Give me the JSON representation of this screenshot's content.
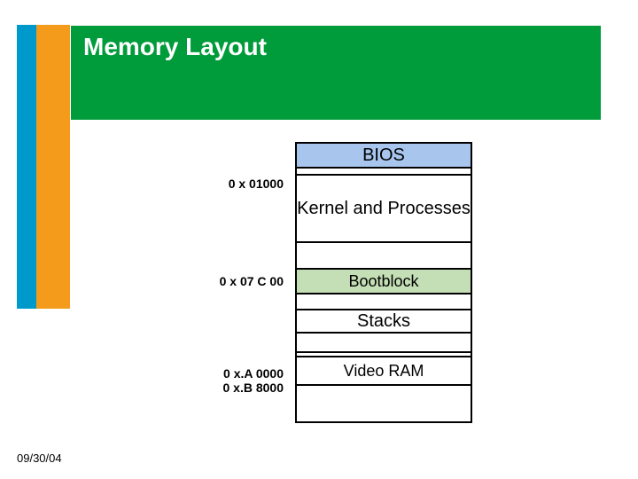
{
  "title": "Memory Layout",
  "addresses": {
    "a1": "0 x 01000",
    "a2": "0 x 07 C 00",
    "a3": "0 x.A 0000",
    "a4": "0 x.B 8000"
  },
  "regions": {
    "bios": "BIOS",
    "kernel": "Kernel and Processes",
    "bootblock": "Bootblock",
    "stacks": "Stacks",
    "videoram": "Video RAM"
  },
  "footer": {
    "date": "09/30/04"
  },
  "colors": {
    "blue": "#0099cc",
    "orange": "#f49b1b",
    "green": "#009b3a",
    "bios_fill": "#a8c6ed",
    "bootblock_fill": "#c4dfb5"
  }
}
